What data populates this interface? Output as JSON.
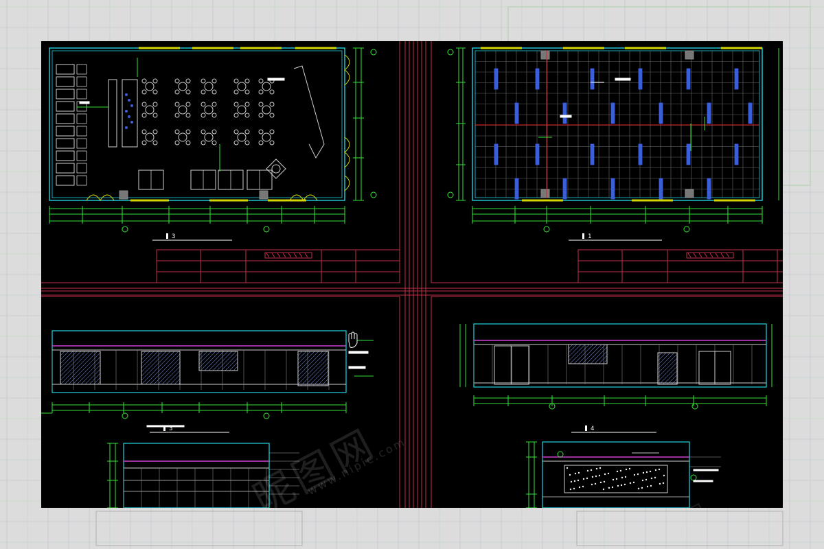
{
  "watermark": {
    "brand": "昵图网",
    "url": "www.nipic.com"
  },
  "colors": {
    "sheet_bg": "#000000",
    "frame_red": "#c0304a",
    "wall_cyan": "#22d4e6",
    "dim_green": "#33e633",
    "window_yellow": "#d6d600",
    "furniture": "#d0d0d0",
    "grid_blue": "#3a5fd8",
    "axis_red": "#e02020",
    "magenta": "#d040d0"
  },
  "drawings": [
    {
      "id": "floor-plan",
      "title_no": "3"
    },
    {
      "id": "ceiling-plan",
      "title_no": "1"
    },
    {
      "id": "elevation-a",
      "title_no": "3"
    },
    {
      "id": "elevation-b",
      "title_no": "4"
    },
    {
      "id": "elevation-c",
      "title_no": ""
    },
    {
      "id": "elevation-d",
      "title_no": ""
    }
  ]
}
